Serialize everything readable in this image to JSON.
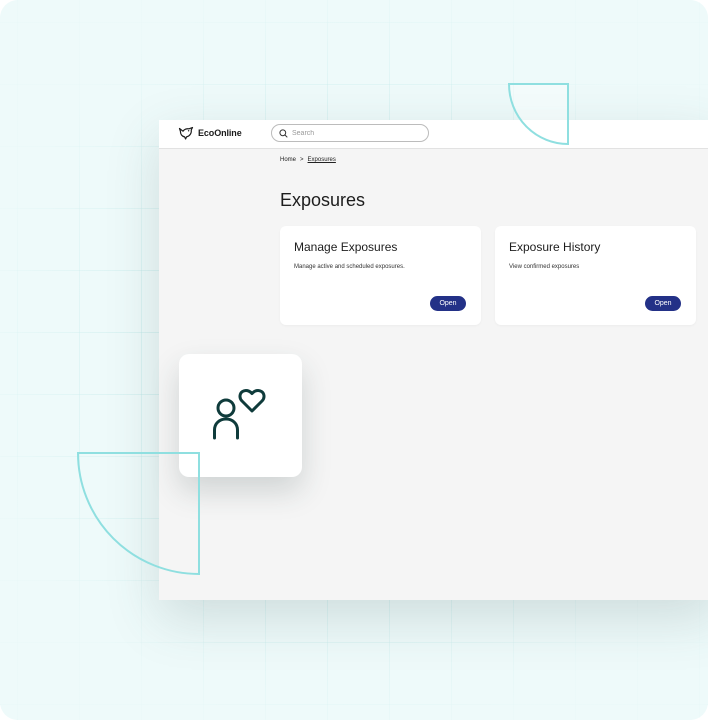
{
  "app": {
    "logo_text": "EcoOnline"
  },
  "search": {
    "placeholder": "Search",
    "value": ""
  },
  "breadcrumb": {
    "home": "Home",
    "separator": ">",
    "current": "Exposures"
  },
  "page": {
    "title": "Exposures"
  },
  "cards": [
    {
      "title": "Manage Exposures",
      "description": "Manage active and scheduled exposures.",
      "button_label": "Open"
    },
    {
      "title": "Exposure History",
      "description": "View confirmed exposures",
      "button_label": "Open"
    }
  ],
  "colors": {
    "primary_button": "#233187",
    "decor_teal": "#8fdfe0",
    "icon_dark": "#0f3b3b"
  },
  "icons": {
    "logo": "bird-logo-icon",
    "search": "search-icon",
    "feature": "person-heart-icon"
  }
}
